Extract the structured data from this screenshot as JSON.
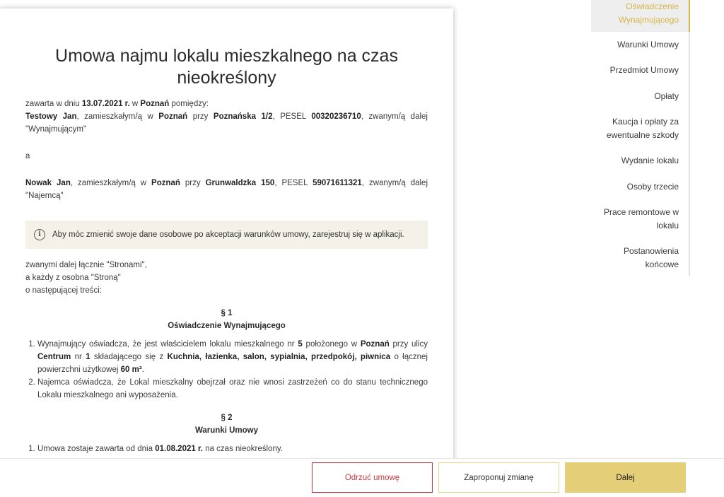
{
  "document": {
    "title": "Umowa najmu lokalu mieszkalnego na czas nieokreślony",
    "intro_prefix": "zawarta w dniu ",
    "intro_date": "13.07.2021 r.",
    "intro_mid": " w ",
    "intro_city": "Poznań",
    "intro_suffix": " pomiędzy:",
    "landlord": {
      "name": "Testowy Jan",
      "t1": ", zamieszkałym/ą w ",
      "city": "Poznań",
      "t2": " przy ",
      "street": "Poznańska 1/2",
      "t3": ", PESEL ",
      "pesel": "00320236710",
      "t4": ", zwanym/ą dalej \"Wynajmującym\""
    },
    "and_word": "a",
    "tenant": {
      "name": "Nowak Jan",
      "t1": ", zamieszkałym/ą w ",
      "city": "Poznań",
      "t2": " przy ",
      "street": "Grunwaldzka 150",
      "t3": ", PESEL ",
      "pesel": "59071611321",
      "t4": ", zwanym/ą dalej \"Najemcą\""
    },
    "info_message": "Aby móc zmienić swoje dane osobowe po akceptacji warunków umowy, zarejestruj się w aplikacji.",
    "info_icon": "i",
    "parties_line1": "zwanymi dalej łącznie \"Stronami\",",
    "parties_line2": "a każdy z osobna \"Stroną\"",
    "parties_line3": "o następującej treści:",
    "s1_number": "§ 1",
    "s1_title": "Oświadczenie Wynajmującego",
    "s1_p1": {
      "a": "Wynajmujący oświadcza, że jest właścicielem lokalu mieszkalnego nr ",
      "nr": "5",
      "b": " położonego w ",
      "city": "Poznań",
      "c": " przy ulicy ",
      "street": "Centrum",
      "d": " nr ",
      "num": "1",
      "e": " składającego się z ",
      "rooms": "Kuchnia, łazienka, salon, sypialnia, przedpokój, piwnica",
      "f": " o łącznej powierzchni użytkowej ",
      "area": "60 m²",
      "g": "."
    },
    "s1_p2": "Najemca oświadcza, że Lokal mieszkalny obejrzał oraz nie wnosi zastrzeżeń co do stanu technicznego Lokalu mieszkalnego ani wyposażenia.",
    "s2_number": "§ 2",
    "s2_title": "Warunki Umowy",
    "s2_p1": {
      "a": "Umowa zostaje zawarta od dnia ",
      "date": "01.08.2021 r.",
      "b": " na czas nieokreślony."
    }
  },
  "toc": {
    "items": [
      {
        "label_l1": "Oświadczenie",
        "label_l2": "Wynajmującego"
      },
      {
        "label_l1": "Warunki Umowy"
      },
      {
        "label_l1": "Przedmiot Umowy"
      },
      {
        "label_l1": "Opłaty"
      },
      {
        "label_l1": "Kaucja i opłaty za",
        "label_l2": "ewentualne szkody"
      },
      {
        "label_l1": "Wydanie lokalu"
      },
      {
        "label_l1": "Osoby trzecie"
      },
      {
        "label_l1": "Prace remontowe w",
        "label_l2": "lokalu"
      },
      {
        "label_l1": "Postanowienia",
        "label_l2": "końcowe"
      }
    ],
    "active_color": "#d6b548"
  },
  "footer": {
    "reject_label": "Odrzuć umowę",
    "propose_label": "Zaproponuj zmianę",
    "next_label": "Dalej"
  },
  "colors": {
    "accent_gold": "#e4cf78",
    "reject_red": "#c9363e",
    "info_bg": "#f3f1e8"
  }
}
